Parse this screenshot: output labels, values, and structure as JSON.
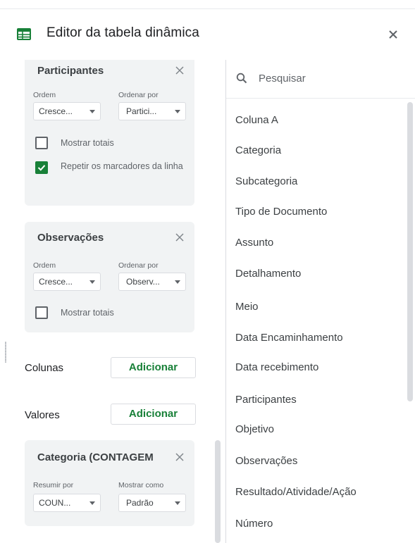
{
  "header": {
    "title": "Editor da tabela dinâmica",
    "accent_color": "#188038",
    "icons": {
      "app": "sheets-table-icon",
      "close": "close-icon"
    }
  },
  "rows_section": {
    "cards": [
      {
        "title": "Participantes",
        "order_label": "Ordem",
        "order_value": "Cresce...",
        "sort_by_label": "Ordenar por",
        "sort_by_value": "Partici...",
        "show_totals_label": "Mostrar totais",
        "show_totals_checked": false,
        "repeat_labels_label": "Repetir os marcadores da linha",
        "repeat_labels_checked": true
      },
      {
        "title": "Observações",
        "order_label": "Ordem",
        "order_value": "Cresce...",
        "sort_by_label": "Ordenar por",
        "sort_by_value": "Observ...",
        "show_totals_label": "Mostrar totais",
        "show_totals_checked": false
      }
    ]
  },
  "columns_section": {
    "label": "Colunas",
    "add_label": "Adicionar"
  },
  "values_section": {
    "label": "Valores",
    "add_label": "Adicionar",
    "card": {
      "title": "Categoria (CONTAGEM",
      "summarize_label": "Resumir por",
      "summarize_value": "COUN...",
      "show_as_label": "Mostrar como",
      "show_as_value": "Padrão"
    }
  },
  "field_list": {
    "search_placeholder": "Pesquisar",
    "items": [
      "Coluna A",
      "Categoria",
      "Subcategoria",
      "Tipo de Documento",
      "Assunto",
      "Detalhamento",
      "Meio",
      "Data Encaminhamento",
      "Data recebimento",
      "Participantes",
      "Objetivo",
      "Observações",
      "Resultado/Atividade/Ação",
      "Número"
    ]
  }
}
